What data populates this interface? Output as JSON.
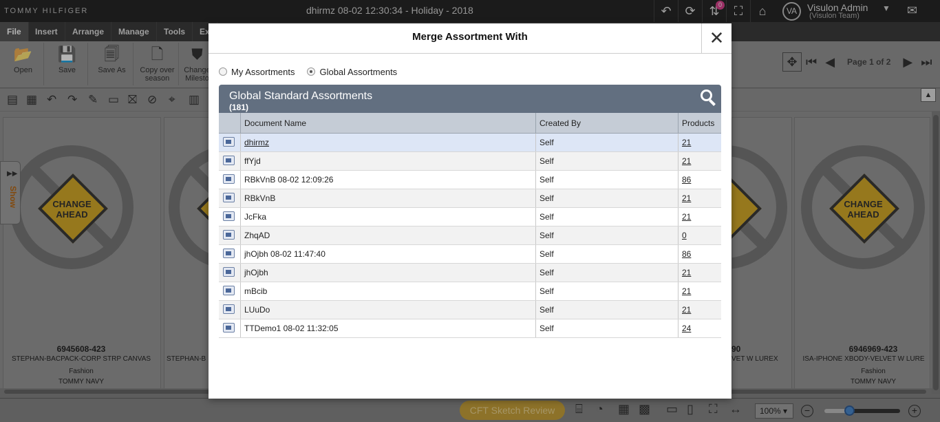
{
  "app": {
    "brand": "TOMMY HILFIGER",
    "document_title": "dhirmz 08-02 12:30:34 - Holiday - 2018",
    "notification_count": "0",
    "user": {
      "initials": "VA",
      "name": "Visulon Admin",
      "team": "(Visulon Team)"
    },
    "menu": [
      "File",
      "Insert",
      "Arrange",
      "Manage",
      "Tools",
      "Ex"
    ],
    "ribbon": [
      {
        "label": "Open",
        "icon": "folder-icon"
      },
      {
        "label": "Save",
        "icon": "save-icon"
      },
      {
        "label": "Save As",
        "icon": "save-as-icon"
      },
      {
        "label": "Copy over season",
        "icon": "copy-icon"
      },
      {
        "label": "Change Milesto",
        "icon": "milestone-icon"
      }
    ],
    "pager": {
      "text": "Page 1 of 2"
    },
    "show_tab": "Show",
    "cards": [
      {
        "code": "6945608-423",
        "name": "STEPHAN-BACPACK-CORP STRP CANVAS",
        "category": "Fashion",
        "color": "TOMMY NAVY",
        "sign": "CHANGE AHEAD"
      },
      {
        "code": "",
        "name": "STEPHAN-B",
        "category": "",
        "color": "",
        "sign": "CHANGE AHEAD"
      },
      {
        "code": "90",
        "name": "VET W LUREX",
        "category": "",
        "color": "",
        "sign": "CHANGE AHEAD"
      },
      {
        "code": "6946969-423",
        "name": "ISA-IPHONE XBODY-VELVET W LURE",
        "category": "Fashion",
        "color": "TOMMY NAVY",
        "sign": "CHANGE AHEAD"
      }
    ],
    "status": {
      "cft_button": "CFT Sketch Review",
      "zoom": "100%"
    }
  },
  "modal": {
    "title": "Merge Assortment With",
    "close_label": "✕",
    "radios": [
      {
        "label": "My Assortments",
        "checked": false
      },
      {
        "label": "Global Assortments",
        "checked": true
      }
    ],
    "grid": {
      "title": "Global Standard Assortments",
      "count": "(181)",
      "columns": [
        "Document Name",
        "Created By",
        "Products"
      ],
      "rows": [
        {
          "name": "dhirmz",
          "created_by": "Self",
          "products": "21",
          "selected": true
        },
        {
          "name": "ffYjd",
          "created_by": "Self",
          "products": "21"
        },
        {
          "name": "RBkVnB 08-02 12:09:26",
          "created_by": "Self",
          "products": "86"
        },
        {
          "name": "RBkVnB",
          "created_by": "Self",
          "products": "21"
        },
        {
          "name": "JcFka",
          "created_by": "Self",
          "products": "21"
        },
        {
          "name": "ZhqAD",
          "created_by": "Self",
          "products": "0"
        },
        {
          "name": "jhOjbh 08-02 11:47:40",
          "created_by": "Self",
          "products": "86"
        },
        {
          "name": "jhOjbh",
          "created_by": "Self",
          "products": "21"
        },
        {
          "name": "mBcib",
          "created_by": "Self",
          "products": "21"
        },
        {
          "name": "LUuDo",
          "created_by": "Self",
          "products": "21"
        },
        {
          "name": "TTDemo1 08-02 11:32:05",
          "created_by": "Self",
          "products": "24"
        }
      ]
    }
  }
}
